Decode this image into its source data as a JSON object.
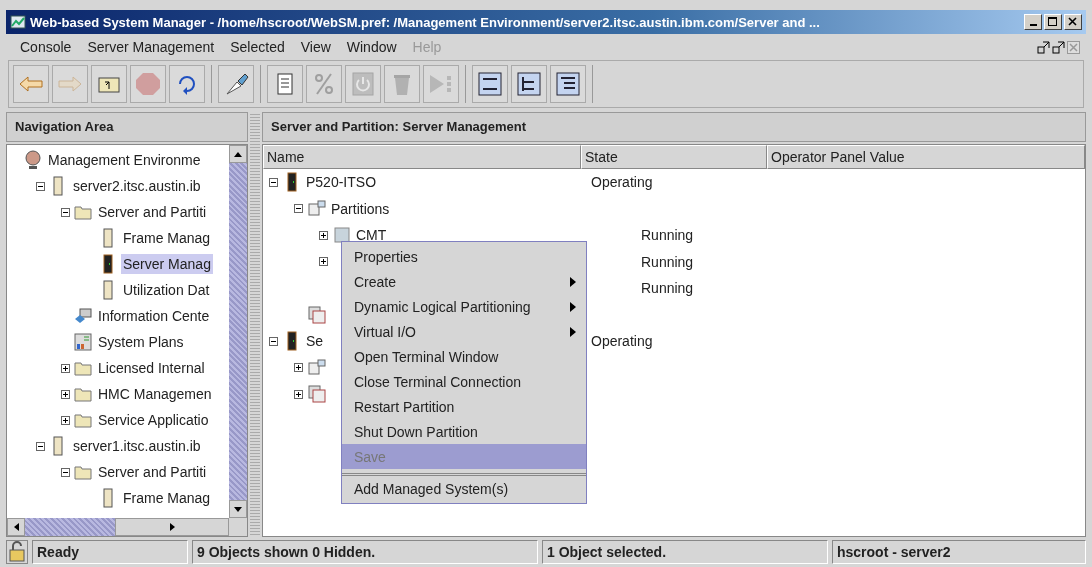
{
  "window": {
    "title": "Web-based System Manager - /home/hscroot/WebSM.pref: /Management Environment/server2.itsc.austin.ibm.com/Server and ..."
  },
  "menu_bar": [
    {
      "label": "Console",
      "disabled": false
    },
    {
      "label": "Server Management",
      "disabled": false
    },
    {
      "label": "Selected",
      "disabled": false
    },
    {
      "label": "View",
      "disabled": false
    },
    {
      "label": "Window",
      "disabled": false
    },
    {
      "label": "Help",
      "disabled": true
    }
  ],
  "toolbar_groups": [
    {
      "buttons": [
        {
          "kind": "back",
          "disabled": false
        },
        {
          "kind": "forward",
          "disabled": true
        },
        {
          "kind": "up",
          "disabled": false
        },
        {
          "kind": "stop",
          "disabled": true
        },
        {
          "kind": "refresh",
          "disabled": false
        }
      ]
    },
    {
      "buttons": [
        {
          "kind": "brush",
          "disabled": false
        }
      ]
    },
    {
      "buttons": [
        {
          "kind": "properties",
          "disabled": false
        },
        {
          "kind": "percent",
          "disabled": true
        },
        {
          "kind": "power",
          "disabled": true
        },
        {
          "kind": "trash",
          "disabled": true
        },
        {
          "kind": "run",
          "disabled": true
        }
      ]
    },
    {
      "buttons": [
        {
          "kind": "list-view",
          "disabled": false
        },
        {
          "kind": "tree-view",
          "disabled": false
        },
        {
          "kind": "detail-view",
          "disabled": false
        }
      ]
    }
  ],
  "navigation": {
    "title": "Navigation Area",
    "tree": [
      {
        "label": "Management Environme",
        "kind": "globe",
        "selected": false,
        "children": [
          {
            "label": "server2.itsc.austin.ib",
            "kind": "server",
            "expanded": true,
            "selected": false,
            "children": [
              {
                "label": "Server and Partiti",
                "kind": "folder",
                "expanded": true,
                "selected": false,
                "children": [
                  {
                    "label": "Frame Manag",
                    "kind": "server",
                    "selected": false
                  },
                  {
                    "label": "Server Manag",
                    "kind": "server-dark",
                    "selected": true
                  },
                  {
                    "label": "Utilization Dat",
                    "kind": "server",
                    "selected": false
                  }
                ]
              },
              {
                "label": "Information Cente",
                "kind": "info",
                "selected": false
              },
              {
                "label": "System Plans",
                "kind": "plans",
                "selected": false
              },
              {
                "label": "Licensed Internal",
                "kind": "folder",
                "expanded": false,
                "selected": false
              },
              {
                "label": "HMC Managemen",
                "kind": "folder",
                "expanded": false,
                "selected": false
              },
              {
                "label": "Service Applicatio",
                "kind": "folder",
                "expanded": false,
                "selected": false
              }
            ]
          },
          {
            "label": "server1.itsc.austin.ib",
            "kind": "server",
            "expanded": true,
            "selected": false,
            "children": [
              {
                "label": "Server and Partiti",
                "kind": "folder",
                "expanded": true,
                "selected": false,
                "children": [
                  {
                    "label": "Frame Manag",
                    "kind": "server",
                    "selected": false
                  }
                ]
              }
            ]
          }
        ]
      }
    ]
  },
  "content": {
    "title": "Server and Partition: Server Management",
    "columns": [
      "Name",
      "State",
      "Operator Panel Value"
    ],
    "rows": [
      {
        "name": "P520-ITSO",
        "kind": "server-dark",
        "state": "Operating",
        "expanded": true,
        "children": [
          {
            "name": "Partitions",
            "kind": "partitions",
            "expanded": true,
            "children": [
              {
                "name": "CMT",
                "kind": "partition",
                "state": "Running",
                "expanded": false
              },
              {
                "state": "Running",
                "expanded": false
              },
              {
                "state": "Running"
              }
            ]
          },
          {
            "kind": "profiles"
          }
        ]
      },
      {
        "name": "Se",
        "kind": "server-dark",
        "state": "Operating",
        "expanded": true,
        "children": [
          {
            "kind": "partitions",
            "expanded": false
          },
          {
            "kind": "profiles",
            "expanded": false
          }
        ]
      }
    ]
  },
  "context_menu": {
    "items": [
      {
        "label": "Properties",
        "submenu": false,
        "disabled": false,
        "selected": false,
        "separator_before": false
      },
      {
        "label": "Create",
        "submenu": true,
        "disabled": false,
        "selected": false,
        "separator_before": false
      },
      {
        "label": "Dynamic Logical Partitioning",
        "submenu": true,
        "disabled": false,
        "selected": false,
        "separator_before": false
      },
      {
        "label": "Virtual I/O",
        "submenu": true,
        "disabled": false,
        "selected": false,
        "separator_before": false
      },
      {
        "label": "Open Terminal Window",
        "submenu": false,
        "disabled": false,
        "selected": false,
        "separator_before": false
      },
      {
        "label": "Close Terminal Connection",
        "submenu": false,
        "disabled": false,
        "selected": false,
        "separator_before": false
      },
      {
        "label": "Restart Partition",
        "submenu": false,
        "disabled": false,
        "selected": false,
        "separator_before": false
      },
      {
        "label": "Shut Down Partition",
        "submenu": false,
        "disabled": false,
        "selected": false,
        "separator_before": false
      },
      {
        "label": "Save",
        "submenu": false,
        "disabled": true,
        "selected": true,
        "separator_before": false
      },
      {
        "label": "Add Managed System(s)",
        "submenu": false,
        "disabled": false,
        "selected": false,
        "separator_before": true
      }
    ]
  },
  "status_bar": {
    "cells": [
      "Ready",
      "9 Objects shown 0 Hidden.",
      "1 Object selected.",
      "hscroot - server2"
    ]
  }
}
